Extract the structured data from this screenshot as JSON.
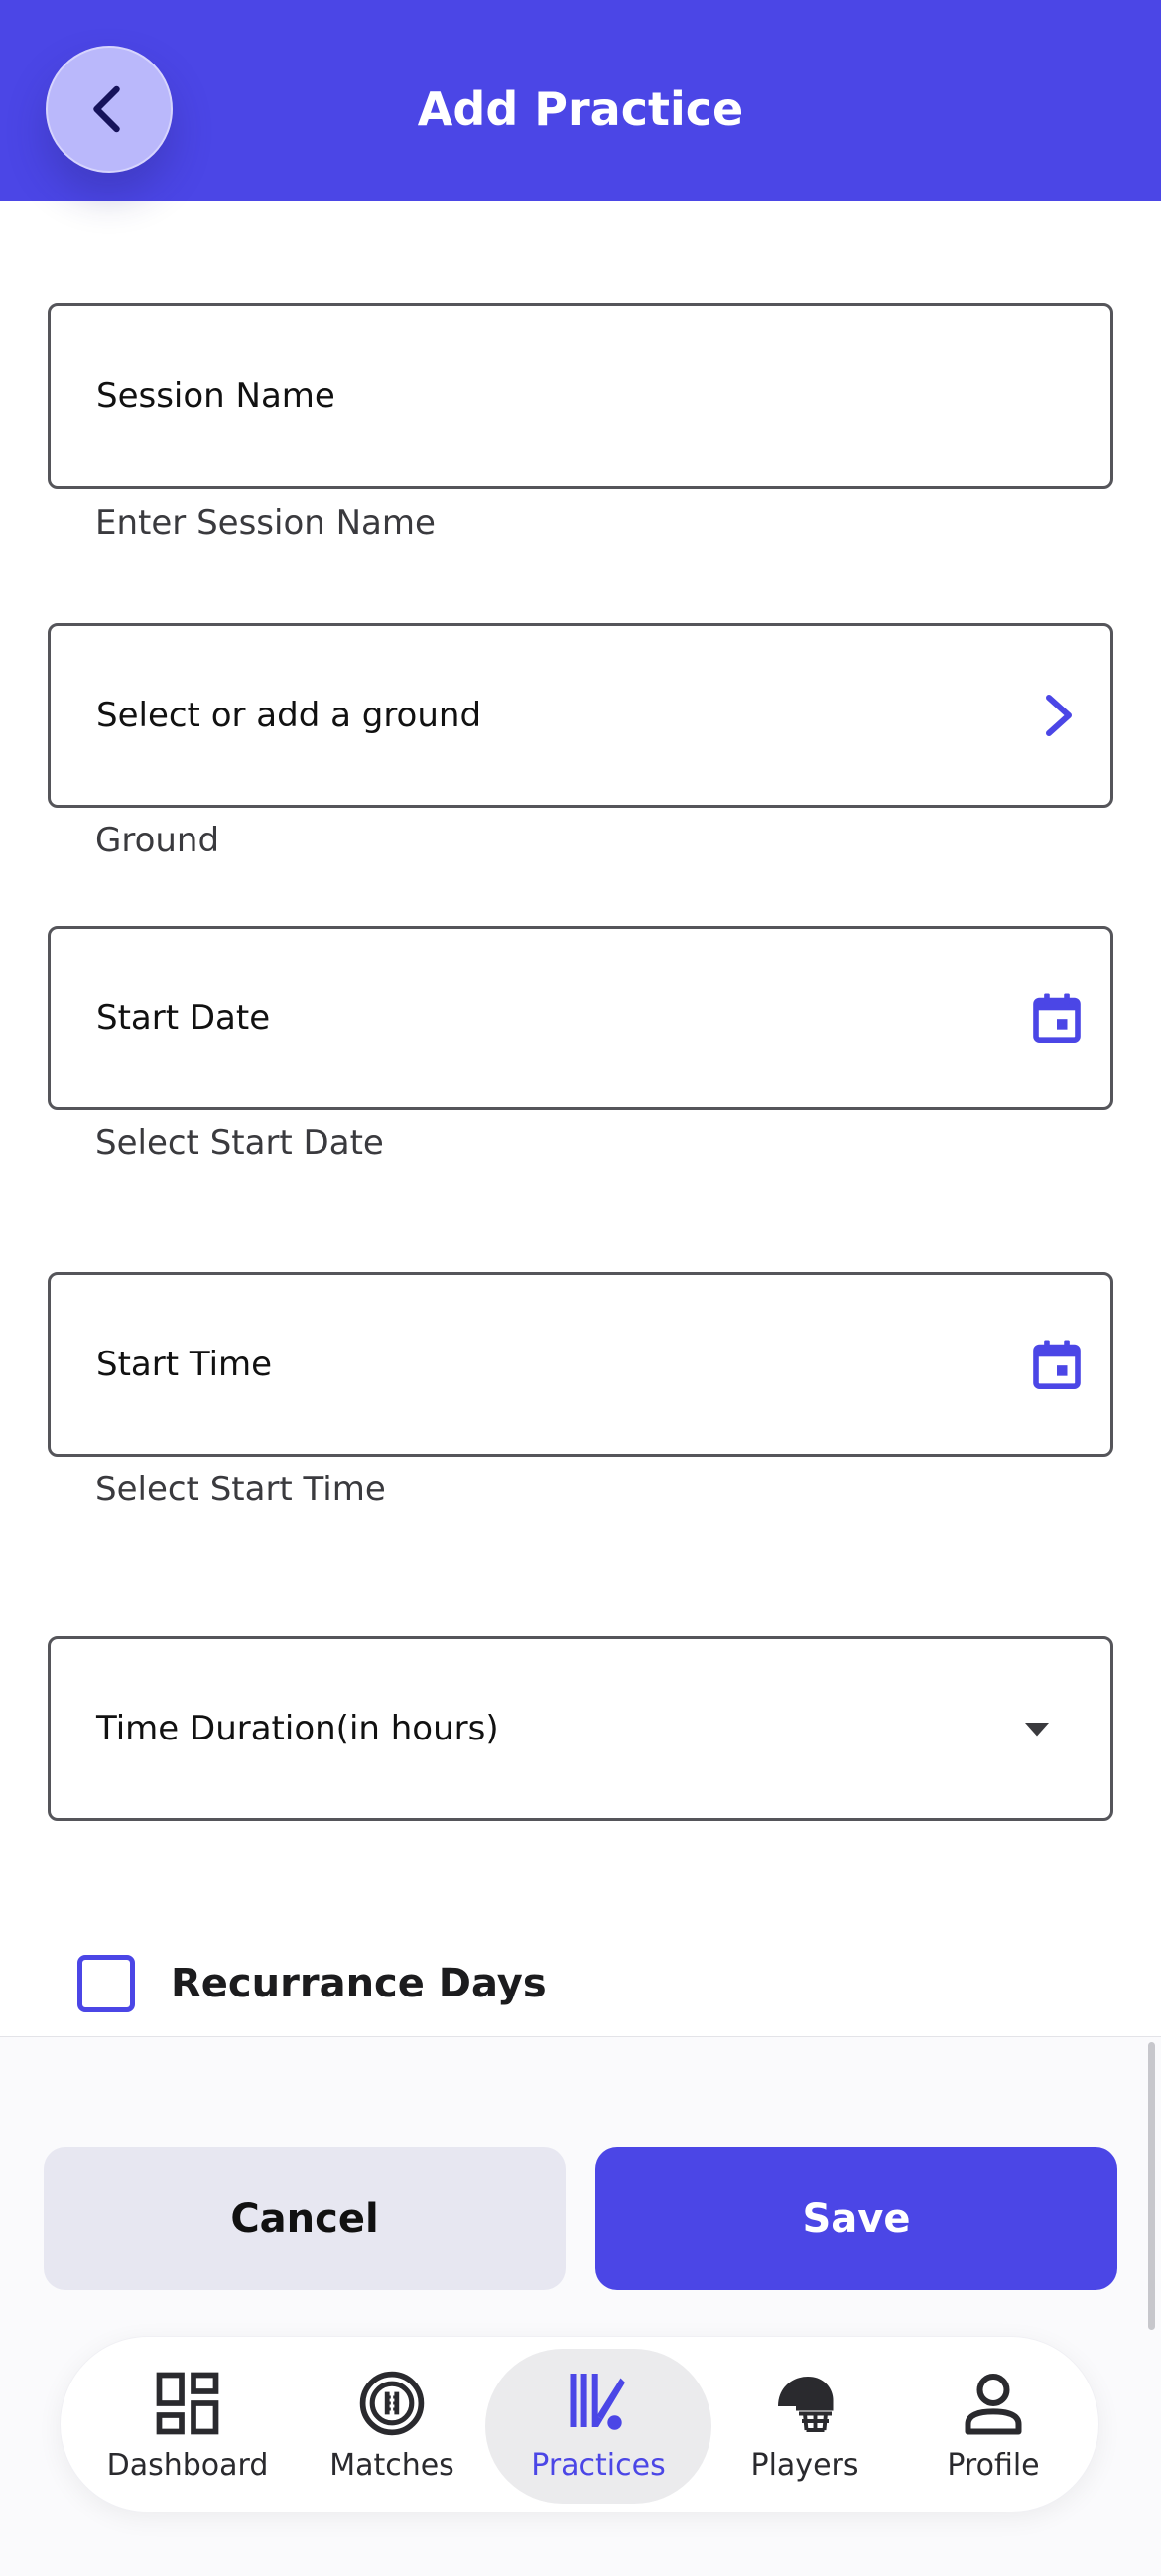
{
  "header": {
    "title": "Add Practice"
  },
  "form": {
    "session_name": {
      "label": "Session Name",
      "helper": "Enter Session Name"
    },
    "ground": {
      "label": "Select or add a ground",
      "helper": "Ground"
    },
    "start_date": {
      "label": "Start Date",
      "helper": "Select Start Date"
    },
    "start_time": {
      "label": "Start Time",
      "helper": "Select Start Time"
    },
    "duration": {
      "label": "Time Duration(in hours)"
    },
    "recurrence": {
      "label": "Recurrance Days",
      "checked": false
    }
  },
  "actions": {
    "cancel_label": "Cancel",
    "save_label": "Save"
  },
  "tabs": [
    {
      "label": "Dashboard",
      "icon": "dashboard-icon"
    },
    {
      "label": "Matches",
      "icon": "cricket-ball-icon"
    },
    {
      "label": "Practices",
      "icon": "cricket-bat-stumps-icon",
      "active": true
    },
    {
      "label": "Players",
      "icon": "helmet-icon"
    },
    {
      "label": "Profile",
      "icon": "person-icon"
    }
  ],
  "colors": {
    "accent": "#4b46e6",
    "back_button": "#bab8fb",
    "cancel_bg": "#e7e7f1"
  }
}
